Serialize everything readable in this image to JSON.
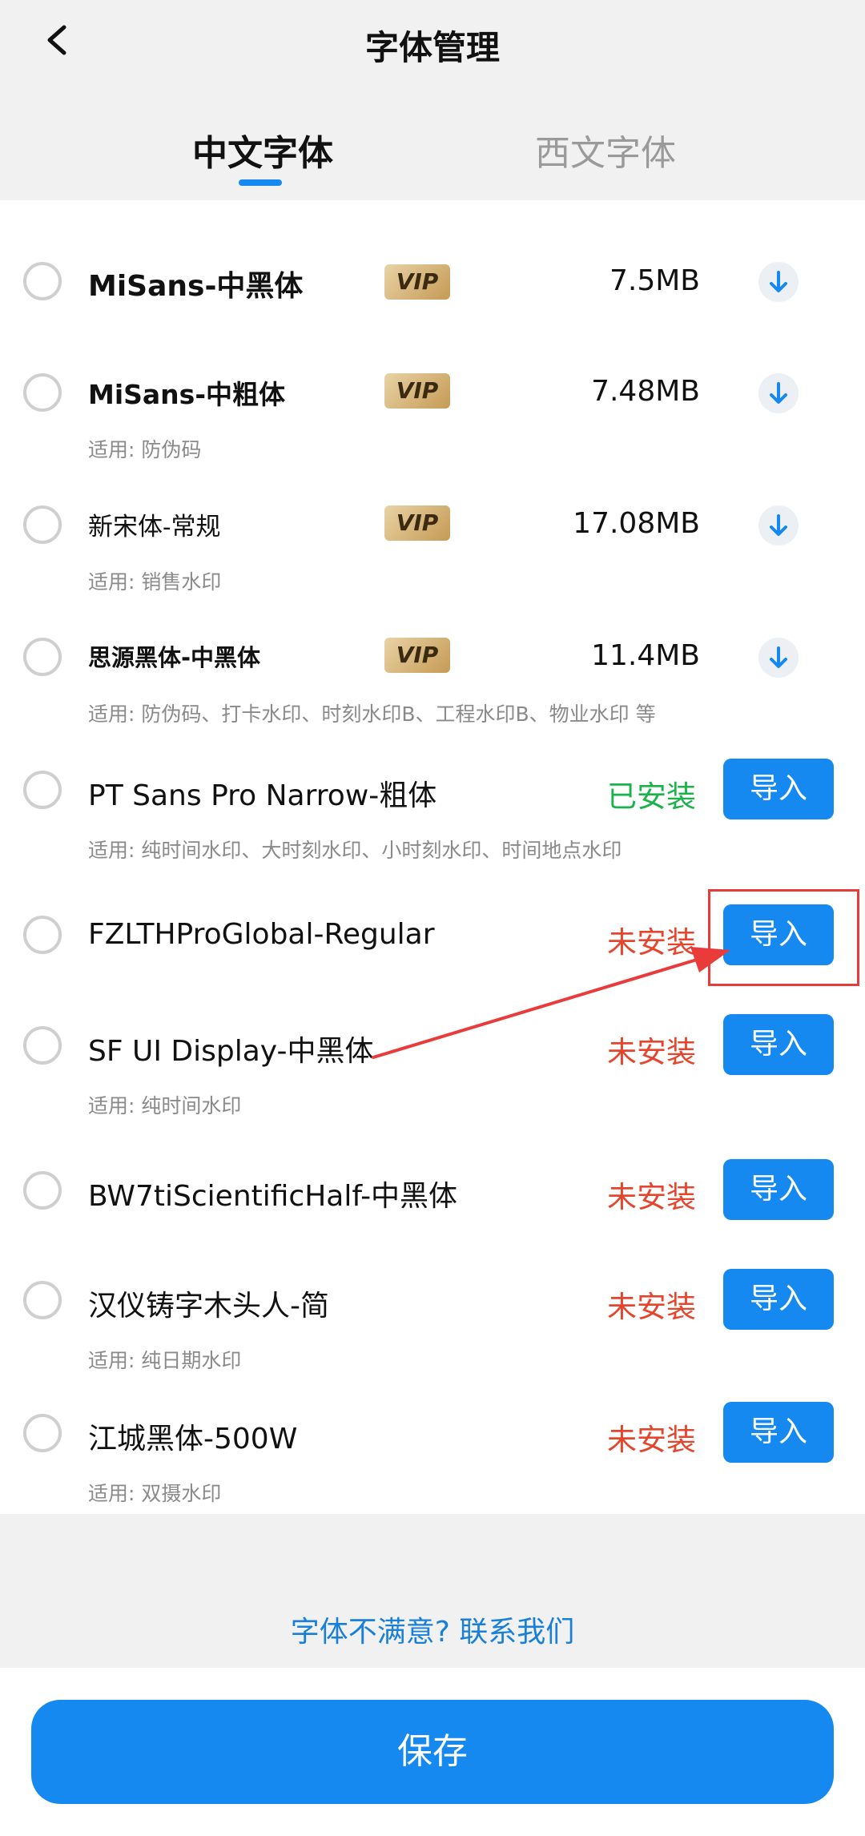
{
  "header": {
    "title": "字体管理",
    "back_icon": "chevron-left-icon"
  },
  "tabs": [
    {
      "label": "中文字体",
      "active": true
    },
    {
      "label": "西文字体",
      "active": false
    }
  ],
  "fonts": [
    {
      "name": "MiSans-中黑体",
      "badge": "VIP",
      "size": "7.5MB",
      "action": "download",
      "sub": ""
    },
    {
      "name": "MiSans-中粗体",
      "badge": "VIP",
      "size": "7.48MB",
      "action": "download",
      "sub": "适用: 防伪码"
    },
    {
      "name": "新宋体-常规",
      "badge": "VIP",
      "size": "17.08MB",
      "action": "download",
      "sub": "适用: 销售水印"
    },
    {
      "name": "思源黑体-中黑体",
      "badge": "VIP",
      "size": "11.4MB",
      "action": "download",
      "sub": "适用: 防伪码、打卡水印、时刻水印B、工程水印B、物业水印 等"
    },
    {
      "name": "PT Sans Pro Narrow-粗体",
      "status": "已安装",
      "button": "导入",
      "sub": "适用: 纯时间水印、大时刻水印、小时刻水印、时间地点水印"
    },
    {
      "name": "FZLTHProGlobal-Regular",
      "status": "未安装",
      "button": "导入",
      "sub": ""
    },
    {
      "name": "SF UI Display-中黑体",
      "status": "未安装",
      "button": "导入",
      "sub": "适用: 纯时间水印"
    },
    {
      "name": "BW7tiScientificHalf-中黑体",
      "status": "未安装",
      "button": "导入",
      "sub": ""
    },
    {
      "name": "汉仪铸字木头人-简",
      "status": "未安装",
      "button": "导入",
      "sub": "适用: 纯日期水印"
    },
    {
      "name": "江城黑体-500W",
      "status": "未安装",
      "button": "导入",
      "sub": "适用: 双摄水印"
    }
  ],
  "footer": {
    "contact": "字体不满意? 联系我们",
    "save": "保存"
  },
  "colors": {
    "accent": "#1589f0",
    "installed": "#19b34a",
    "not_installed": "#e6452d",
    "annotation": "#ea3b3b"
  }
}
